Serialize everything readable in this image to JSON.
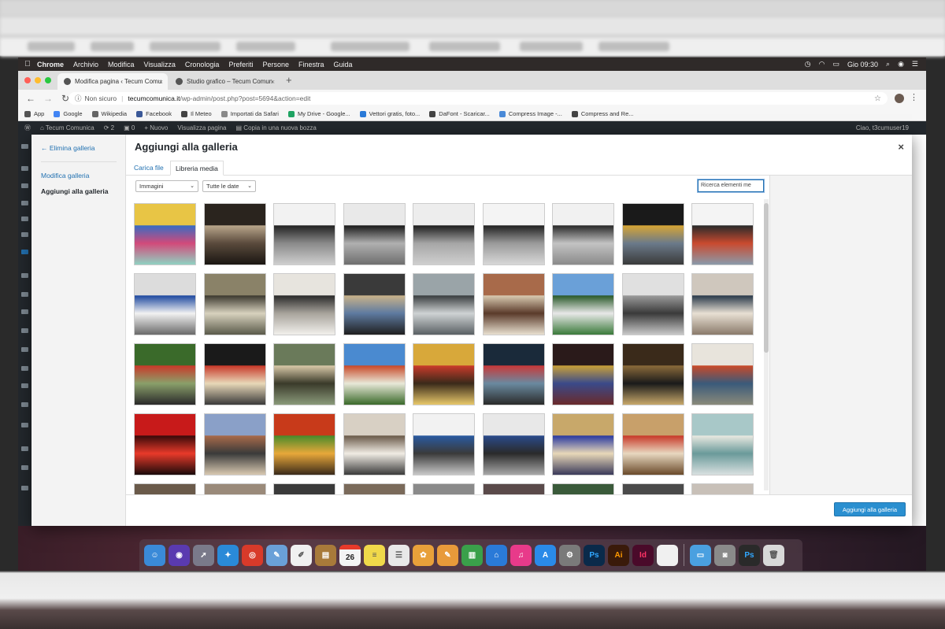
{
  "menubar": {
    "apple": "",
    "items": [
      "Chrome",
      "Archivio",
      "Modifica",
      "Visualizza",
      "Cronologia",
      "Preferiti",
      "Persone",
      "Finestra",
      "Guida"
    ],
    "clock": "Gio 09:30"
  },
  "browser": {
    "tabs": [
      {
        "label": "Modifica pagina ‹ Tecum Comu",
        "active": true
      },
      {
        "label": "Studio grafico – Tecum Comun",
        "active": false
      }
    ],
    "new_tab": "+",
    "security": "Non sicuro",
    "url_host": "tecumcomunica.it",
    "url_path": "/wp-admin/post.php?post=5694&action=edit",
    "bookmarks": [
      "App",
      "Google",
      "Wikipedia",
      "Facebook",
      "Il Meteo",
      "Importati da Safari",
      "My Drive - Google...",
      "Vettori gratis, foto...",
      "DaFont - Scaricar...",
      "Compress Image -...",
      "Compress and Re..."
    ]
  },
  "wp_admin_bar": {
    "site": "Tecum Comunica",
    "updates": "2",
    "comments": "0",
    "new": "+ Nuovo",
    "view": "Visualizza pagina",
    "copy": "Copia in una nuova bozza",
    "howdy": "Ciao, t3cumuser19"
  },
  "modal": {
    "back_link": "← Elimina galleria",
    "menu": [
      "Modifica galleria",
      "Aggiungi alla galleria"
    ],
    "title": "Aggiungi alla galleria",
    "close": "×",
    "tabs": [
      "Carica file",
      "Libreria media"
    ],
    "filter_type": "Immagini",
    "filter_date": "Tutte le date",
    "search_placeholder": "Ricerca elementi me",
    "primary_button": "Aggiungi alla galleria",
    "thumbnails": [
      {
        "desc": "color-print-swatches",
        "colors": [
          "#e8c545",
          "#3a6bc1",
          "#d24a7a",
          "#8fd1c2"
        ]
      },
      {
        "desc": "gallery-room-dark",
        "colors": [
          "#2a241e",
          "#b8a58a",
          "#5a4a3c",
          "#1a1612"
        ]
      },
      {
        "desc": "office-reception-1",
        "colors": [
          "#f2f2f2",
          "#222222",
          "#8a8a8a",
          "#cfcfcf"
        ]
      },
      {
        "desc": "office-reception-2",
        "colors": [
          "#e9e9e9",
          "#1b1b1b",
          "#b0b0b0",
          "#6e6e6e"
        ]
      },
      {
        "desc": "office-reception-3",
        "colors": [
          "#ededed",
          "#1e1e1e",
          "#a6a6a6",
          "#cfcfcf"
        ]
      },
      {
        "desc": "office-reception-4",
        "colors": [
          "#f4f4f4",
          "#222222",
          "#9a9a9a",
          "#d8d8d8"
        ]
      },
      {
        "desc": "office-reception-5",
        "colors": [
          "#f1f1f1",
          "#2a2a2a",
          "#c3c3c3",
          "#8a8a8a"
        ]
      },
      {
        "desc": "wrapped-van-black",
        "colors": [
          "#1a1a1a",
          "#d6a536",
          "#6b7a8a",
          "#3a3a3a"
        ]
      },
      {
        "desc": "tecnobar-van",
        "colors": [
          "#f4f4f4",
          "#2a2a2a",
          "#c94a2f",
          "#8a9aaa"
        ]
      },
      {
        "desc": "sign-panel-blue",
        "colors": [
          "#dcdcdc",
          "#1f4aa0",
          "#f2f2f2",
          "#6a6a6a"
        ]
      },
      {
        "desc": "building-entrance",
        "colors": [
          "#8a8268",
          "#3d3a30",
          "#d8d2be",
          "#5a5a4a"
        ]
      },
      {
        "desc": "exhibition-wall",
        "colors": [
          "#e7e4de",
          "#2a2a2a",
          "#a8a49c",
          "#f2f0ec"
        ]
      },
      {
        "desc": "shop-interior",
        "colors": [
          "#3a3a3a",
          "#c8b28a",
          "#5e7aa0",
          "#1f1f1f"
        ]
      },
      {
        "desc": "street-shopfront",
        "colors": [
          "#9aa4a8",
          "#3a3e40",
          "#cfd3d4",
          "#5a6064"
        ]
      },
      {
        "desc": "brick-wall-banner",
        "colors": [
          "#a86a4a",
          "#d8c9b0",
          "#5a3a2a",
          "#e8e0d0"
        ]
      },
      {
        "desc": "outdoor-sign-totem",
        "colors": [
          "#6aa0d8",
          "#2a5a2a",
          "#e8e8e8",
          "#3a7a3a"
        ]
      },
      {
        "desc": "hall-interior",
        "colors": [
          "#e0e0e0",
          "#9a9a9a",
          "#3a3a3a",
          "#c8c8c8"
        ]
      },
      {
        "desc": "info-totem",
        "colors": [
          "#cfc7bd",
          "#2a3a4a",
          "#e8e0d4",
          "#8a7a6a"
        ]
      },
      {
        "desc": "red-totem-park",
        "colors": [
          "#3a6a2a",
          "#c83a2a",
          "#8aa06a",
          "#2a2a2a"
        ]
      },
      {
        "desc": "display-boards",
        "colors": [
          "#1a1a1a",
          "#c83a2a",
          "#e8d8b8",
          "#3a3a3a"
        ]
      },
      {
        "desc": "outdoor-exhibit",
        "colors": [
          "#6a7a5a",
          "#d8c8a8",
          "#3a3a2a",
          "#8a9a7a"
        ]
      },
      {
        "desc": "billboard-sky",
        "colors": [
          "#4a8ad0",
          "#c84a2a",
          "#e8e8d8",
          "#3a6a2a"
        ]
      },
      {
        "desc": "sports-court",
        "colors": [
          "#d8a83a",
          "#c83a2a",
          "#3a2a1a",
          "#e8c86a"
        ]
      },
      {
        "desc": "arena-scoreboard",
        "colors": [
          "#1a2a3a",
          "#c83a3a",
          "#6a8aa0",
          "#2a2a2a"
        ]
      },
      {
        "desc": "ubi-banca-arena",
        "colors": [
          "#2a1a1a",
          "#c8a03a",
          "#3a4a8a",
          "#6a2a2a"
        ]
      },
      {
        "desc": "arena-stands",
        "colors": [
          "#3a2a1a",
          "#8a6a3a",
          "#1a1a1a",
          "#c8a86a"
        ]
      },
      {
        "desc": "shop-door-poster",
        "colors": [
          "#e8e4dc",
          "#c84a2a",
          "#3a5a7a",
          "#8a8a7a"
        ]
      },
      {
        "desc": "red-stage-event",
        "colors": [
          "#c81a1a",
          "#3a0a0a",
          "#e83a2a",
          "#1a0a0a"
        ]
      },
      {
        "desc": "old-street-building",
        "colors": [
          "#8aa0c8",
          "#a86a4a",
          "#3a3a3a",
          "#d8c8b0"
        ]
      },
      {
        "desc": "vegetables-wall",
        "colors": [
          "#c83a1a",
          "#4a8a2a",
          "#e8a83a",
          "#3a2a1a"
        ]
      },
      {
        "desc": "kitchen-people",
        "colors": [
          "#d8d0c4",
          "#6a5a4a",
          "#f0ece4",
          "#3a3a3a"
        ]
      },
      {
        "desc": "police-car-1",
        "colors": [
          "#f2f2f2",
          "#2a5aa0",
          "#3a3a3a",
          "#c8c8c8"
        ]
      },
      {
        "desc": "police-car-2",
        "colors": [
          "#e8e8e8",
          "#2a4a8a",
          "#2a2a2a",
          "#a8a8a8"
        ]
      },
      {
        "desc": "blue-booth",
        "colors": [
          "#c8a86a",
          "#2a3aa0",
          "#e8d8b8",
          "#3a3a5a"
        ]
      },
      {
        "desc": "arch-shop",
        "colors": [
          "#c8a06a",
          "#c83a2a",
          "#e8d8c0",
          "#6a4a2a"
        ]
      },
      {
        "desc": "pattern-wall",
        "colors": [
          "#a8c8c8",
          "#e8e8e0",
          "#6a9a9a",
          "#d8e0e0"
        ]
      }
    ]
  },
  "dock": {
    "calendar_day": "26",
    "items": [
      {
        "name": "finder-icon",
        "color": "#3a8ad8",
        "glyph": "☺"
      },
      {
        "name": "siri-icon",
        "color": "#5a3ab0",
        "glyph": "◉"
      },
      {
        "name": "launchpad-icon",
        "color": "#7a7a8a",
        "glyph": "➚"
      },
      {
        "name": "safari-icon",
        "color": "#2a8ad8",
        "glyph": "✦"
      },
      {
        "name": "chrome-icon",
        "color": "#d83a2a",
        "glyph": "◎"
      },
      {
        "name": "preview-icon",
        "color": "#6aa0d8",
        "glyph": "✎"
      },
      {
        "name": "textedit-icon",
        "color": "#f0f0f0",
        "glyph": "✐"
      },
      {
        "name": "notes-brown-icon",
        "color": "#a87a3a",
        "glyph": "▤"
      },
      {
        "name": "calendar-icon",
        "color": "#f4f4f4",
        "glyph": ""
      },
      {
        "name": "notes-icon",
        "color": "#f0d84a",
        "glyph": "≡"
      },
      {
        "name": "reminders-icon",
        "color": "#e8e8e8",
        "glyph": "☰"
      },
      {
        "name": "photos-icon",
        "color": "#e8a03a",
        "glyph": "✿"
      },
      {
        "name": "pages-icon",
        "color": "#e89a3a",
        "glyph": "✎"
      },
      {
        "name": "numbers-icon",
        "color": "#3aa04a",
        "glyph": "▥"
      },
      {
        "name": "keynote-icon",
        "color": "#2a7ad8",
        "glyph": "⌂"
      },
      {
        "name": "itunes-icon",
        "color": "#e83a8a",
        "glyph": "♫"
      },
      {
        "name": "appstore-icon",
        "color": "#2a8ae8",
        "glyph": "A"
      },
      {
        "name": "system-preferences-icon",
        "color": "#7a7a7a",
        "glyph": "⚙"
      },
      {
        "name": "photoshop-icon",
        "color": "#0a2a4a",
        "glyph": "Ps"
      },
      {
        "name": "illustrator-icon",
        "color": "#3a1a0a",
        "glyph": "Ai"
      },
      {
        "name": "indesign-icon",
        "color": "#4a0a2a",
        "glyph": "Id"
      },
      {
        "name": "document-icon",
        "color": "#f0f0f0",
        "glyph": ""
      },
      {
        "name": "separator",
        "color": "",
        "glyph": ""
      },
      {
        "name": "folder-icon",
        "color": "#4aa0e0",
        "glyph": "▭"
      },
      {
        "name": "screenshot-icon",
        "color": "#8a8a8a",
        "glyph": "◙"
      },
      {
        "name": "ps-file-icon",
        "color": "#2a2a2a",
        "glyph": "Ps"
      },
      {
        "name": "trash-icon",
        "color": "#d8d8d8",
        "glyph": "🗑"
      }
    ]
  }
}
